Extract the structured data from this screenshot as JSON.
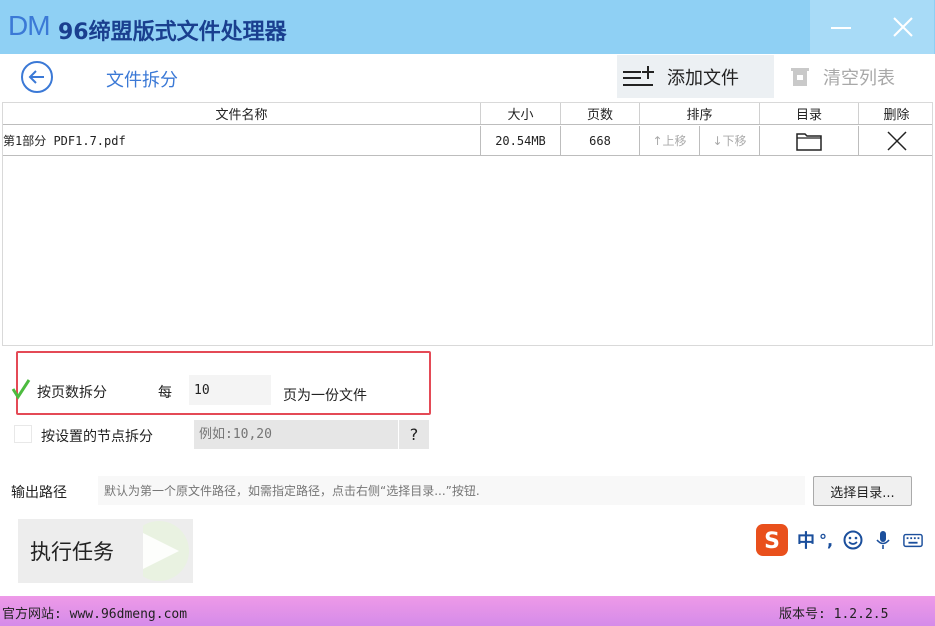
{
  "app": {
    "logo": "DM",
    "title": "96缔盟版式文件处理器"
  },
  "toolbar": {
    "page_title": "文件拆分",
    "add_file_label": "添加文件",
    "clear_list_label": "清空列表"
  },
  "table": {
    "headers": [
      "文件名称",
      "大小",
      "页数",
      "排序",
      "目录",
      "删除"
    ],
    "rows": [
      {
        "name": "第1部分 PDF1.7.pdf",
        "size": "20.54MB",
        "pages": "668",
        "move_up_label": "↑上移",
        "move_down_label": "↓下移"
      }
    ]
  },
  "options": {
    "by_pages_label": "按页数拆分",
    "by_pages_checked": true,
    "every_label": "每",
    "pages_value": "10",
    "pages_suffix": "页为一份文件",
    "by_nodes_label": "按设置的节点拆分",
    "by_nodes_checked": false,
    "nodes_placeholder": "例如:10,20",
    "help_label": "?"
  },
  "output": {
    "label": "输出路径",
    "placeholder": "默认为第一个原文件路径，如需指定路径，点击右侧“选择目录...”按钮.",
    "select_button": "选择目录..."
  },
  "run": {
    "label": "执行任务"
  },
  "ime": {
    "lang": "中",
    "punct": "°,"
  },
  "status": {
    "website": "官方网站:  www.96dmeng.com",
    "version": "版本号: 1.2.2.5"
  },
  "colors": {
    "titlebar": "#8fd0f4",
    "accent": "#3b79d6",
    "highlight_border": "#e44a56",
    "check": "#4cbb3f",
    "statusbar": "#e896e9"
  }
}
